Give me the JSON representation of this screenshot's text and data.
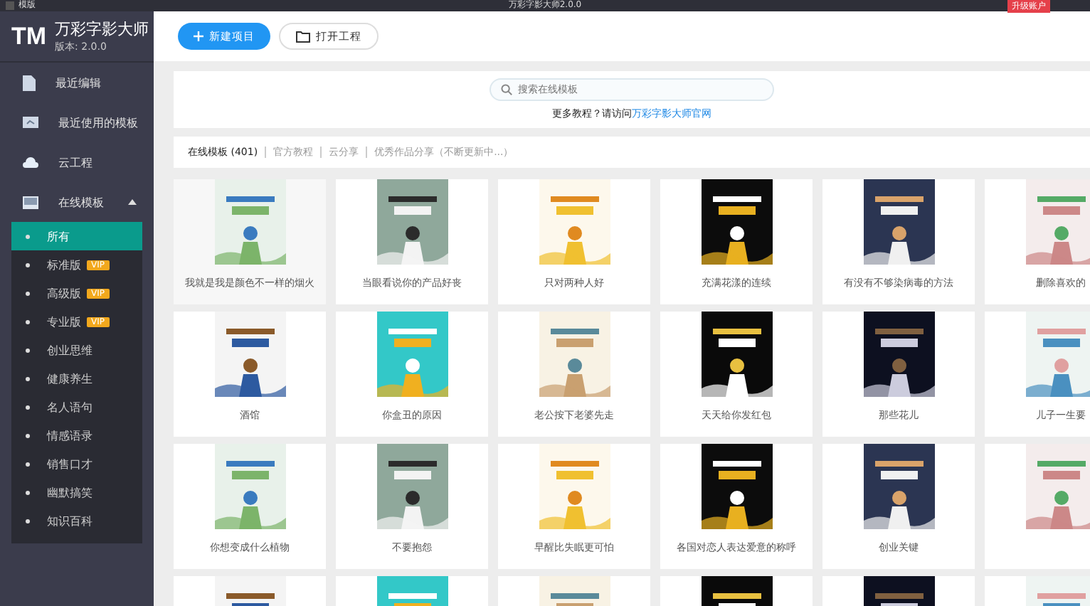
{
  "titlebar": {
    "app_label": "模版",
    "title": "万彩字影大师2.0.0",
    "action": "升级账户"
  },
  "sidebar": {
    "logo": "TM",
    "app_name": "万彩字影大师",
    "version": "版本: 2.0.0",
    "items": [
      {
        "label": "最近编辑"
      },
      {
        "label": "最近使用的模板"
      },
      {
        "label": "云工程"
      },
      {
        "label": "在线模板",
        "expanded": true,
        "children": [
          {
            "label": "所有",
            "selected": true
          },
          {
            "label": "标准版",
            "selected": false,
            "badge": "VIP"
          },
          {
            "label": "高级版",
            "selected": false,
            "badge": "VIP"
          },
          {
            "label": "专业版",
            "selected": false,
            "badge": "VIP"
          },
          {
            "label": "创业思维",
            "selected": false
          },
          {
            "label": "健康养生",
            "selected": false
          },
          {
            "label": "名人语句",
            "selected": false
          },
          {
            "label": "情感语录",
            "selected": false
          },
          {
            "label": "销售口才",
            "selected": false
          },
          {
            "label": "幽默搞笑",
            "selected": false
          },
          {
            "label": "知识百科",
            "selected": false
          }
        ]
      }
    ]
  },
  "toolbar": {
    "buttons": [
      {
        "label": "新建项目",
        "kind": "primary"
      },
      {
        "label": "打开工程",
        "kind": "secondary"
      }
    ]
  },
  "search": {
    "placeholder": "搜索在线模板",
    "hint": "更多教程？请访问",
    "link": "万彩字影大师官网"
  },
  "tabs": [
    {
      "label": "在线模板 (401)",
      "selected": true
    },
    {
      "label": "官方教程",
      "selected": false
    },
    {
      "label": "云分享",
      "selected": false
    },
    {
      "label": "优秀作品分享（不断更新中...）",
      "selected": false
    }
  ],
  "templates": [
    {
      "kind": "template",
      "label": "我就是我是颜色不一样的烟火"
    },
    {
      "kind": "template",
      "label": "当眼看说你的产品好丧"
    },
    {
      "kind": "template",
      "label": "只对两种人好"
    },
    {
      "kind": "template",
      "label": "充满花漾的连续"
    },
    {
      "kind": "template",
      "label": "有没有不够染病毒的方法"
    },
    {
      "kind": "template",
      "label": "删除喜欢的"
    },
    {
      "kind": "template",
      "label": "酒馆"
    },
    {
      "kind": "template",
      "label": "你盒丑的原因"
    },
    {
      "kind": "template",
      "label": "老公按下老婆先走"
    },
    {
      "kind": "template",
      "label": "天天给你发红包"
    },
    {
      "kind": "template",
      "label": "那些花儿"
    },
    {
      "kind": "template",
      "label": "儿子一生要"
    },
    {
      "kind": "template",
      "label": "你想变成什么植物"
    },
    {
      "kind": "template",
      "label": "不要抱怨"
    },
    {
      "kind": "template",
      "label": "早醒比失眠更可怕"
    },
    {
      "kind": "template",
      "label": "各国对恋人表达爱意的称呼"
    },
    {
      "kind": "template",
      "label": "创业关键"
    },
    {
      "kind": "picture"
    },
    {
      "kind": "picture"
    },
    {
      "kind": "picture"
    },
    {
      "kind": "picture"
    },
    {
      "kind": "picture"
    },
    {
      "kind": "picture"
    },
    {
      "kind": "picture"
    }
  ]
}
